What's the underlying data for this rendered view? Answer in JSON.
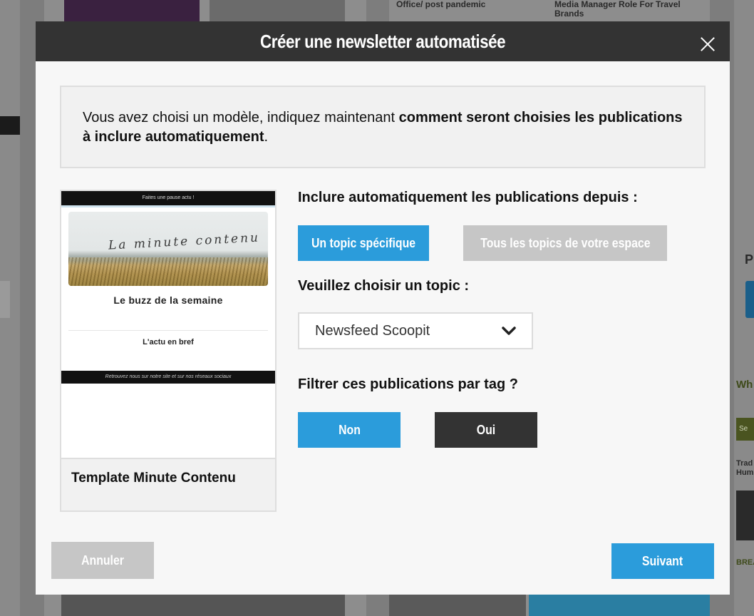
{
  "background": {
    "card_text_1": "Media Manager Role For Travel Brands",
    "card_text_2": "Office/ post pandemic",
    "side_letter": "P",
    "side_heading": "Wh",
    "side_button": "Se",
    "side_text": "Trad Hum",
    "side_label": "BREA"
  },
  "modal": {
    "title": "Créer une newsletter automatisée",
    "intro_plain": "Vous avez choisi un modèle, indiquez maintenant ",
    "intro_bold": "comment seront choisies les publications à inclure automatiquement",
    "intro_end": ".",
    "template": {
      "top_banner": "Faites une pause actu !",
      "hero_title": "La minute contenu",
      "heading": "Le buzz de la semaine",
      "subheading": "L'actu en bref",
      "footer": "Retrouvez nous sur notre site et sur nos réseaux sociaux",
      "name": "Template Minute Contenu"
    },
    "source_label": "Inclure automatiquement les publications depuis :",
    "source_options": {
      "specific": "Un topic spécifique",
      "all": "Tous les topics de votre espace"
    },
    "topic_label": "Veuillez choisir un topic :",
    "topic_selected": "Newsfeed Scoopit",
    "tag_label": "Filtrer ces publications par tag ?",
    "tag_options": {
      "no": "Non",
      "yes": "Oui"
    },
    "cancel_label": "Annuler",
    "next_label": "Suivant"
  },
  "colors": {
    "header": "#333333",
    "primary": "#2b9cdb",
    "disabled": "#c6c6c6",
    "dark_button": "#333333"
  }
}
